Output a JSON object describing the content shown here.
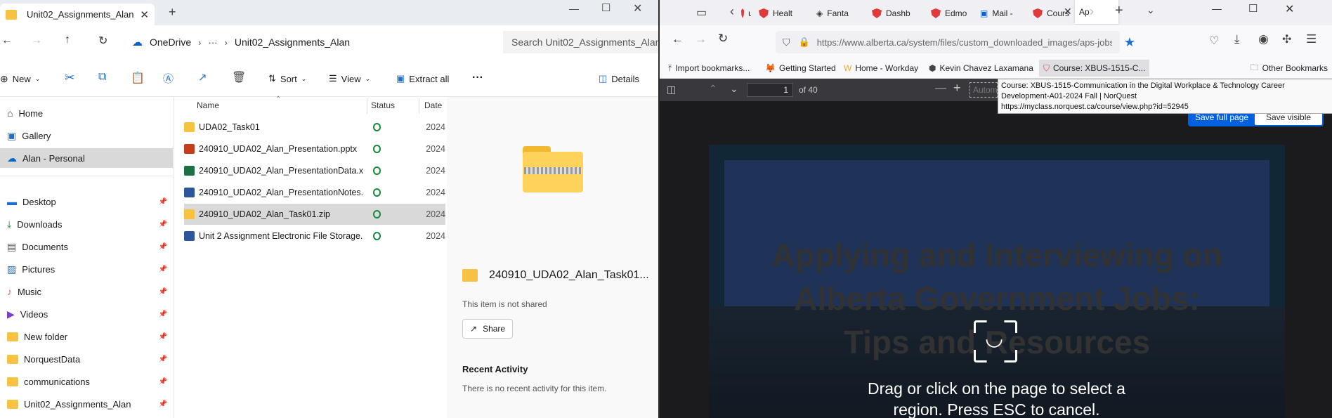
{
  "explorer": {
    "tab_title": "Unit02_Assignments_Alan",
    "address": {
      "root": "OneDrive",
      "ellipsis": "···",
      "folder": "Unit02_Assignments_Alan"
    },
    "search_placeholder": "Search Unit02_Assignments_Alan",
    "toolbar": {
      "new": "New",
      "sort": "Sort",
      "view": "View",
      "extract": "Extract all",
      "more": "···",
      "details": "Details"
    },
    "sidebar": [
      {
        "label": "Home",
        "pinned": false
      },
      {
        "label": "Gallery",
        "pinned": false
      },
      {
        "label": "Alan - Personal",
        "pinned": false
      },
      {
        "label": "Desktop",
        "pinned": true
      },
      {
        "label": "Downloads",
        "pinned": true
      },
      {
        "label": "Documents",
        "pinned": true
      },
      {
        "label": "Pictures",
        "pinned": true
      },
      {
        "label": "Music",
        "pinned": true
      },
      {
        "label": "Videos",
        "pinned": true
      },
      {
        "label": "New folder",
        "pinned": true
      },
      {
        "label": "NorquestData",
        "pinned": true
      },
      {
        "label": "communications",
        "pinned": true
      },
      {
        "label": "Unit02_Assignments_Alan",
        "pinned": true
      }
    ],
    "columns": {
      "name": "Name",
      "status": "Status",
      "date": "Date"
    },
    "files": [
      {
        "name": "UDA02_Task01",
        "type": "folder",
        "date": "2024"
      },
      {
        "name": "240910_UDA02_Alan_Presentation.pptx",
        "type": "pptx",
        "date": "2024"
      },
      {
        "name": "240910_UDA02_Alan_PresentationData.xlsx",
        "type": "xlsx",
        "date": "2024"
      },
      {
        "name": "240910_UDA02_Alan_PresentationNotes....",
        "type": "docx",
        "date": "2024"
      },
      {
        "name": "240910_UDA02_Alan_Task01.zip",
        "type": "zip",
        "date": "2024"
      },
      {
        "name": "Unit 2 Assignment Electronic File Storage...",
        "type": "docx",
        "date": "2024"
      }
    ],
    "details": {
      "filename": "240910_UDA02_Alan_Task01...",
      "sharing": "This item is not shared",
      "share_btn": "Share",
      "activity_title": "Recent Activity",
      "activity_text": "There is no recent activity for this item."
    }
  },
  "browser": {
    "tabs": [
      {
        "label": "ue",
        "icon": "red"
      },
      {
        "label": "Healt",
        "icon": "shield"
      },
      {
        "label": "Fanta",
        "icon": "diamond"
      },
      {
        "label": "Dashb",
        "icon": "shield"
      },
      {
        "label": "Edmo",
        "icon": "shield"
      },
      {
        "label": "Mail -",
        "icon": "outlook"
      },
      {
        "label": "Cours",
        "icon": "shield"
      },
      {
        "label": "Ap",
        "icon": "none"
      }
    ],
    "url": "https://www.alberta.ca/system/files/custom_downloaded_images/aps-jobs-",
    "url_host": "alberta.ca",
    "bookmarks": [
      {
        "label": "Import bookmarks..."
      },
      {
        "label": "Getting Started"
      },
      {
        "label": "Home - Workday"
      },
      {
        "label": "Kevin Chavez Laxamana"
      },
      {
        "label": "Course: XBUS-1515-C..."
      }
    ],
    "other_bookmarks": "Other Bookmarks",
    "pdf": {
      "page": "1",
      "of": "of 40",
      "zoom": "Autom",
      "save_full": "Save full page",
      "save_visible": "Save visible"
    },
    "tooltip": {
      "line1": "Course: XBUS-1515-Communication in the Digital Workplace & Technology Career",
      "line2": "Development-A01-2024 Fall | NorQuest",
      "line3": "https://myclass.norquest.ca/course/view.php?id=52945"
    },
    "slide": {
      "title_line1": "Applying and Interviewing on",
      "title_line2": "Alberta Government Jobs:",
      "title_line3": "Tips and Resources"
    },
    "overlay_text_line1": "Drag or click on the page to select a",
    "overlay_text_line2": "region. Press ESC to cancel."
  }
}
